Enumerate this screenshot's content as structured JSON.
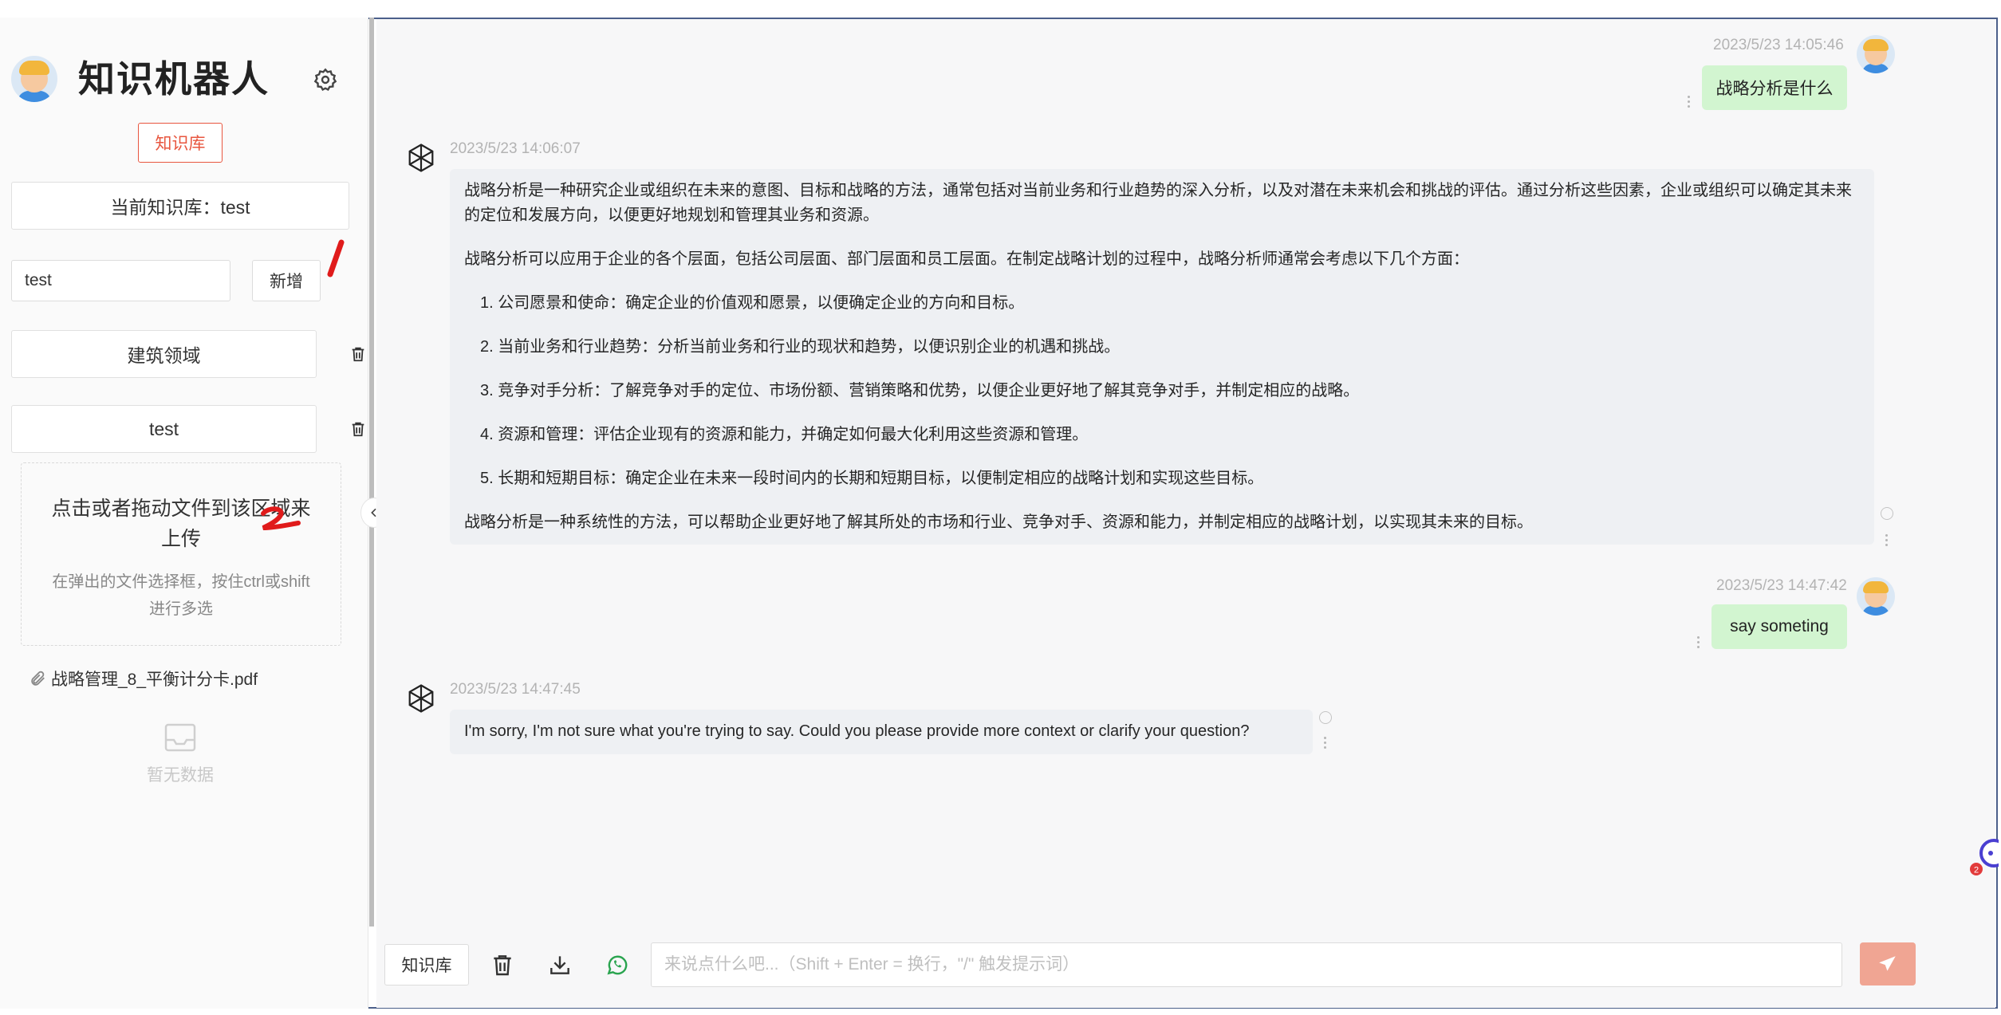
{
  "sidebar": {
    "app_title": "知识机器人",
    "kb_button": "知识库",
    "current_kb": "当前知识库：test",
    "new_kb_input_value": "test",
    "add_button": "新增",
    "kb_items": [
      {
        "label": "建筑领域"
      },
      {
        "label": "test"
      }
    ],
    "upload": {
      "main_text": "点击或者拖动文件到该区域来上传",
      "sub_text": "在弹出的文件选择框，按住ctrl或shift进行多选"
    },
    "files": [
      {
        "name": "战略管理_8_平衡计分卡.pdf"
      }
    ],
    "empty_text": "暂无数据"
  },
  "chat": {
    "messages": [
      {
        "role": "user",
        "time": "2023/5/23 14:05:46",
        "text": "战略分析是什么"
      },
      {
        "role": "bot",
        "time": "2023/5/23 14:06:07",
        "intro": "战略分析是一种研究企业或组织在未来的意图、目标和战略的方法，通常包括对当前业务和行业趋势的深入分析，以及对潜在未来机会和挑战的评估。通过分析这些因素，企业或组织可以确定其未来的定位和发展方向，以便更好地规划和管理其业务和资源。",
        "para2": "战略分析可以应用于企业的各个层面，包括公司层面、部门层面和员工层面。在制定战略计划的过程中，战略分析师通常会考虑以下几个方面：",
        "list": [
          "1. 公司愿景和使命：确定企业的价值观和愿景，以便确定企业的方向和目标。",
          "2. 当前业务和行业趋势：分析当前业务和行业的现状和趋势，以便识别企业的机遇和挑战。",
          "3. 竞争对手分析：了解竞争对手的定位、市场份额、营销策略和优势，以便企业更好地了解其竞争对手，并制定相应的战略。",
          "4. 资源和管理：评估企业现有的资源和能力，并确定如何最大化利用这些资源和管理。",
          "5. 长期和短期目标：确定企业在未来一段时间内的长期和短期目标，以便制定相应的战略计划和实现这些目标。"
        ],
        "conclusion": "战略分析是一种系统性的方法，可以帮助企业更好地了解其所处的市场和行业、竞争对手、资源和能力，并制定相应的战略计划，以实现其未来的目标。"
      },
      {
        "role": "user",
        "time": "2023/5/23 14:47:42",
        "text": "say someting"
      },
      {
        "role": "bot",
        "time": "2023/5/23 14:47:45",
        "text": "I'm sorry, I'm not sure what you're trying to say. Could you please provide more context or clarify your question?"
      }
    ]
  },
  "bottombar": {
    "kb_button": "知识库",
    "input_placeholder": "来说点什么吧...（Shift + Enter = 换行，\"/\" 触发提示词）"
  },
  "float_badge": "2",
  "colors": {
    "accent": "#e8563f",
    "user_bubble": "#d2f5d0",
    "bot_bubble": "#eef0f3",
    "send_button": "#f0a593",
    "whatsapp_icon": "#2aa44f"
  },
  "icons": [
    "gear-icon",
    "trash-icon",
    "paperclip-icon",
    "inbox-icon",
    "chevron-left-icon",
    "openai-icon",
    "download-icon",
    "whatsapp-icon",
    "send-icon"
  ]
}
